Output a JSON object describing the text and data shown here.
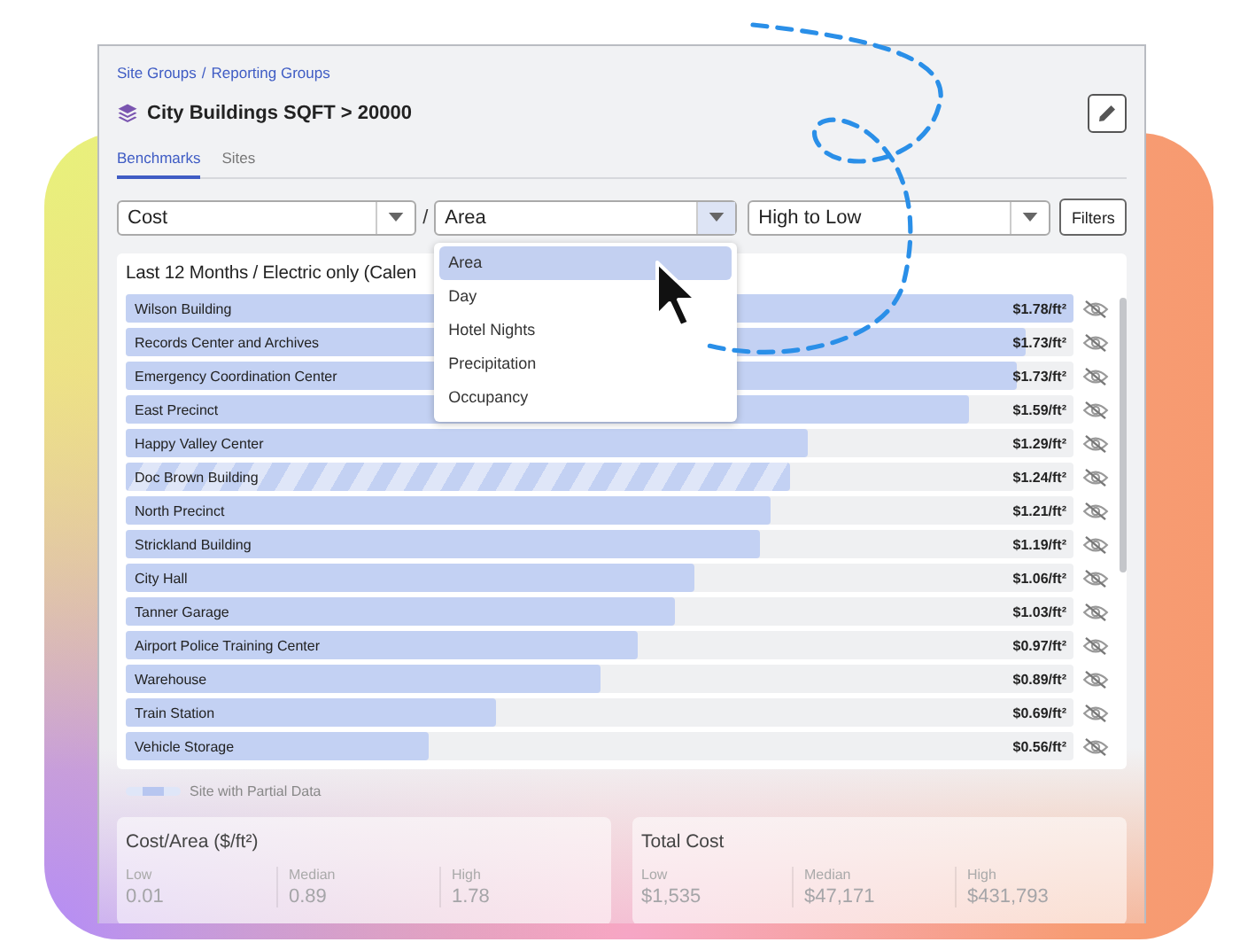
{
  "breadcrumb": {
    "items": [
      {
        "label": "Site Groups"
      },
      {
        "label": "Reporting Groups"
      }
    ],
    "separator": "/"
  },
  "title": "City Buildings SQFT > 20000",
  "tabs": [
    {
      "label": "Benchmarks",
      "selected": true
    },
    {
      "label": "Sites",
      "selected": false
    }
  ],
  "controls": {
    "metric": "Cost",
    "divider": "/",
    "normalizer": "Area",
    "sort": "High to Low",
    "filters_button": "Filters"
  },
  "normalizer_menu": {
    "expanded": true,
    "options": [
      {
        "label": "Area",
        "selected": true
      },
      {
        "label": "Day",
        "selected": false
      },
      {
        "label": "Hotel Nights",
        "selected": false
      },
      {
        "label": "Precipitation",
        "selected": false
      },
      {
        "label": "Occupancy",
        "selected": false
      }
    ]
  },
  "chart": {
    "title": "Last 12 Months / Electric only (Calen",
    "rows": [
      {
        "name": "Wilson Building",
        "value": "$1.78/ft²",
        "level": 1.0,
        "partial": false
      },
      {
        "name": "Records Center and Archives",
        "value": "$1.73/ft²",
        "level": 0.95,
        "partial": false
      },
      {
        "name": "Emergency Coordination Center",
        "value": "$1.73/ft²",
        "level": 0.94,
        "partial": false
      },
      {
        "name": "East Precinct",
        "value": "$1.59/ft²",
        "level": 0.89,
        "partial": false
      },
      {
        "name": "Happy Valley Center",
        "value": "$1.29/ft²",
        "level": 0.72,
        "partial": false
      },
      {
        "name": "Doc Brown Building",
        "value": "$1.24/ft²",
        "level": 0.7,
        "partial": true
      },
      {
        "name": "North Precinct",
        "value": "$1.21/ft²",
        "level": 0.68,
        "partial": false
      },
      {
        "name": "Strickland Building",
        "value": "$1.19/ft²",
        "level": 0.67,
        "partial": false
      },
      {
        "name": "City Hall",
        "value": "$1.06/ft²",
        "level": 0.6,
        "partial": false
      },
      {
        "name": "Tanner Garage",
        "value": "$1.03/ft²",
        "level": 0.58,
        "partial": false
      },
      {
        "name": "Airport Police Training Center",
        "value": "$0.97/ft²",
        "level": 0.54,
        "partial": false
      },
      {
        "name": "Warehouse",
        "value": "$0.89/ft²",
        "level": 0.5,
        "partial": false
      },
      {
        "name": "Train Station",
        "value": "$0.69/ft²",
        "level": 0.39,
        "partial": false
      },
      {
        "name": "Vehicle Storage",
        "value": "$0.56/ft²",
        "level": 0.32,
        "partial": false
      }
    ],
    "legend": "Site with Partial Data"
  },
  "stats": [
    {
      "title": "Cost/Area ($/ft²)",
      "items": [
        {
          "label": "Low",
          "value": "0.01"
        },
        {
          "label": "Median",
          "value": "0.89"
        },
        {
          "label": "High",
          "value": "1.78"
        }
      ]
    },
    {
      "title": "Total Cost",
      "items": [
        {
          "label": "Low",
          "value": "$1,535"
        },
        {
          "label": "Median",
          "value": "$47,171"
        },
        {
          "label": "High",
          "value": "$431,793"
        }
      ]
    }
  ]
}
